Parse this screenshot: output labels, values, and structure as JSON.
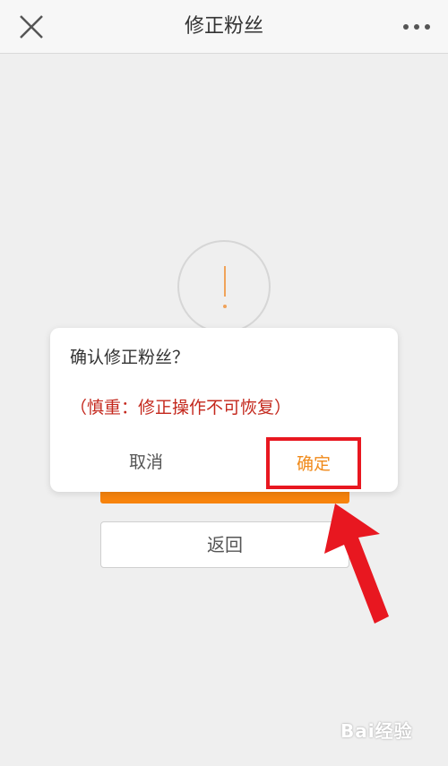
{
  "header": {
    "title": "修正粉丝",
    "close_icon": "close-icon",
    "more_icon": "more-icon"
  },
  "dialog": {
    "title": "确认修正粉丝？",
    "warning": "（慎重：修正操作不可恢复）",
    "cancel_label": "取消",
    "confirm_label": "确定"
  },
  "back_label": "返回",
  "colors": {
    "accent": "#f7830c",
    "warning_text": "#c4281d",
    "highlight": "#e81720"
  },
  "watermark": {
    "text": "Bai经验"
  }
}
